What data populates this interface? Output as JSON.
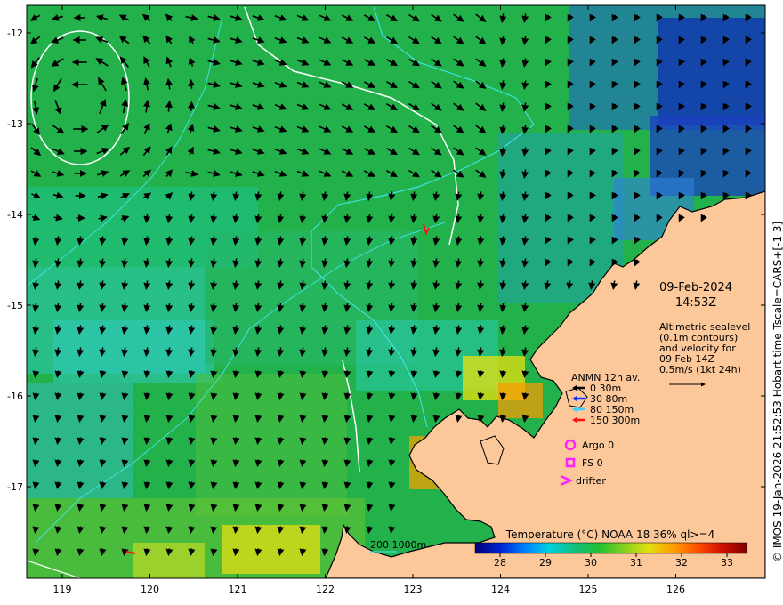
{
  "map": {
    "date_line": "09-Feb-2024",
    "time_line": "14:53Z",
    "description": [
      "Altimetric sealevel",
      "(0.1m contours)",
      "and velocity for",
      "09 Feb 14Z",
      "0.5m/s (1kt 24h)"
    ],
    "credit": "© IMOS 19-Jan-2026 21:52:53 Hobart time Tscale=CARS+[-1 3]",
    "lon_ticks": [
      "119",
      "120",
      "121",
      "122",
      "123",
      "124",
      "125",
      "126"
    ],
    "lat_ticks": [
      "-12",
      "-13",
      "-14",
      "-15",
      "-16",
      "-17"
    ]
  },
  "mooring_legend": {
    "title": "ANMN 12h av.",
    "entries": [
      {
        "label": "0 30m",
        "color": "#000000"
      },
      {
        "label": "30 80m",
        "color": "#1030ff"
      },
      {
        "label": "80 150m",
        "color": "#40d0ff"
      },
      {
        "label": "150 300m",
        "color": "#ff1010"
      }
    ]
  },
  "float_legend": [
    {
      "label": "Argo 0",
      "symbol": "circle-icon",
      "color": "#ff20ff"
    },
    {
      "label": "FS 0",
      "symbol": "square-icon",
      "color": "#ff20ff"
    },
    {
      "label": "drifter",
      "symbol": "chevron-icon",
      "color": "#ff20ff"
    }
  ],
  "depth_legend": {
    "text": "200  1000m",
    "color": "#40e0e0"
  },
  "colorbar": {
    "title": "Temperature (°C) NOAA 18 36% ql>=4",
    "ticks": [
      "28",
      "29",
      "30",
      "31",
      "32",
      "33"
    ],
    "colors": [
      "#00007a",
      "#0020d0",
      "#0080ff",
      "#00d0e0",
      "#10c080",
      "#20c030",
      "#80d020",
      "#e0e010",
      "#ffa000",
      "#ff5000",
      "#d01000",
      "#800000"
    ]
  },
  "colors": {
    "sea": "#22b14a",
    "land": "#fcc89a"
  }
}
